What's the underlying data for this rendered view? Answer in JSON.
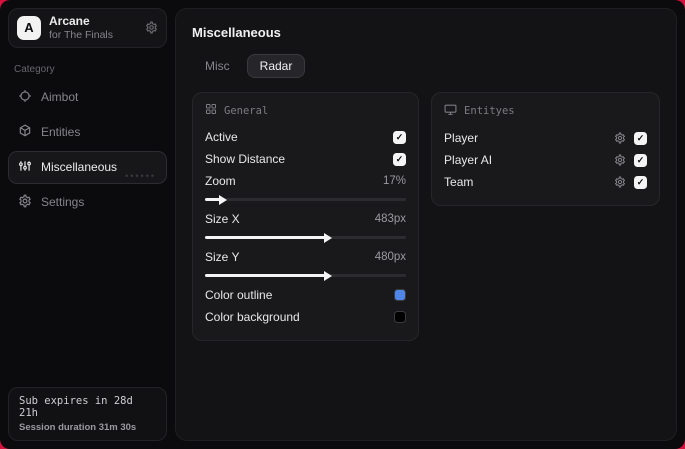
{
  "app": {
    "logo_letter": "A",
    "name": "Arcane",
    "subtitle": "for The Finals"
  },
  "sidebar": {
    "category_label": "Category",
    "items": [
      {
        "label": "Aimbot",
        "active": false
      },
      {
        "label": "Entities",
        "active": false
      },
      {
        "label": "Miscellaneous",
        "active": true
      },
      {
        "label": "Settings",
        "active": false
      }
    ],
    "selected_dots": "••••••",
    "footer": {
      "sub_expires": "Sub expires in 28d 21h",
      "session_duration": "Session duration 31m 30s"
    }
  },
  "main": {
    "title": "Miscellaneous",
    "tabs": [
      {
        "label": "Misc",
        "active": false
      },
      {
        "label": "Radar",
        "active": true
      }
    ]
  },
  "general": {
    "title": "General",
    "active": {
      "label": "Active",
      "checked": true
    },
    "show_distance": {
      "label": "Show Distance",
      "checked": true
    },
    "zoom": {
      "label": "Zoom",
      "value": "17%",
      "fill_pct": 8
    },
    "size_x": {
      "label": "Size X",
      "value": "483px",
      "fill_pct": 60
    },
    "size_y": {
      "label": "Size Y",
      "value": "480px",
      "fill_pct": 60
    },
    "color_outline": {
      "label": "Color outline",
      "color": "#4d86e8"
    },
    "color_background": {
      "label": "Color background",
      "color": "#000000"
    }
  },
  "entities_panel": {
    "title": "Entityes",
    "rows": [
      {
        "label": "Player",
        "checked": true
      },
      {
        "label": "Player AI",
        "checked": true
      },
      {
        "label": "Team",
        "checked": true
      }
    ]
  },
  "glyphs": {
    "check": "✓"
  },
  "colors": {
    "accent_background": "#d5123d",
    "outline_swatch": "#4d86e8",
    "background_swatch": "#000000"
  }
}
